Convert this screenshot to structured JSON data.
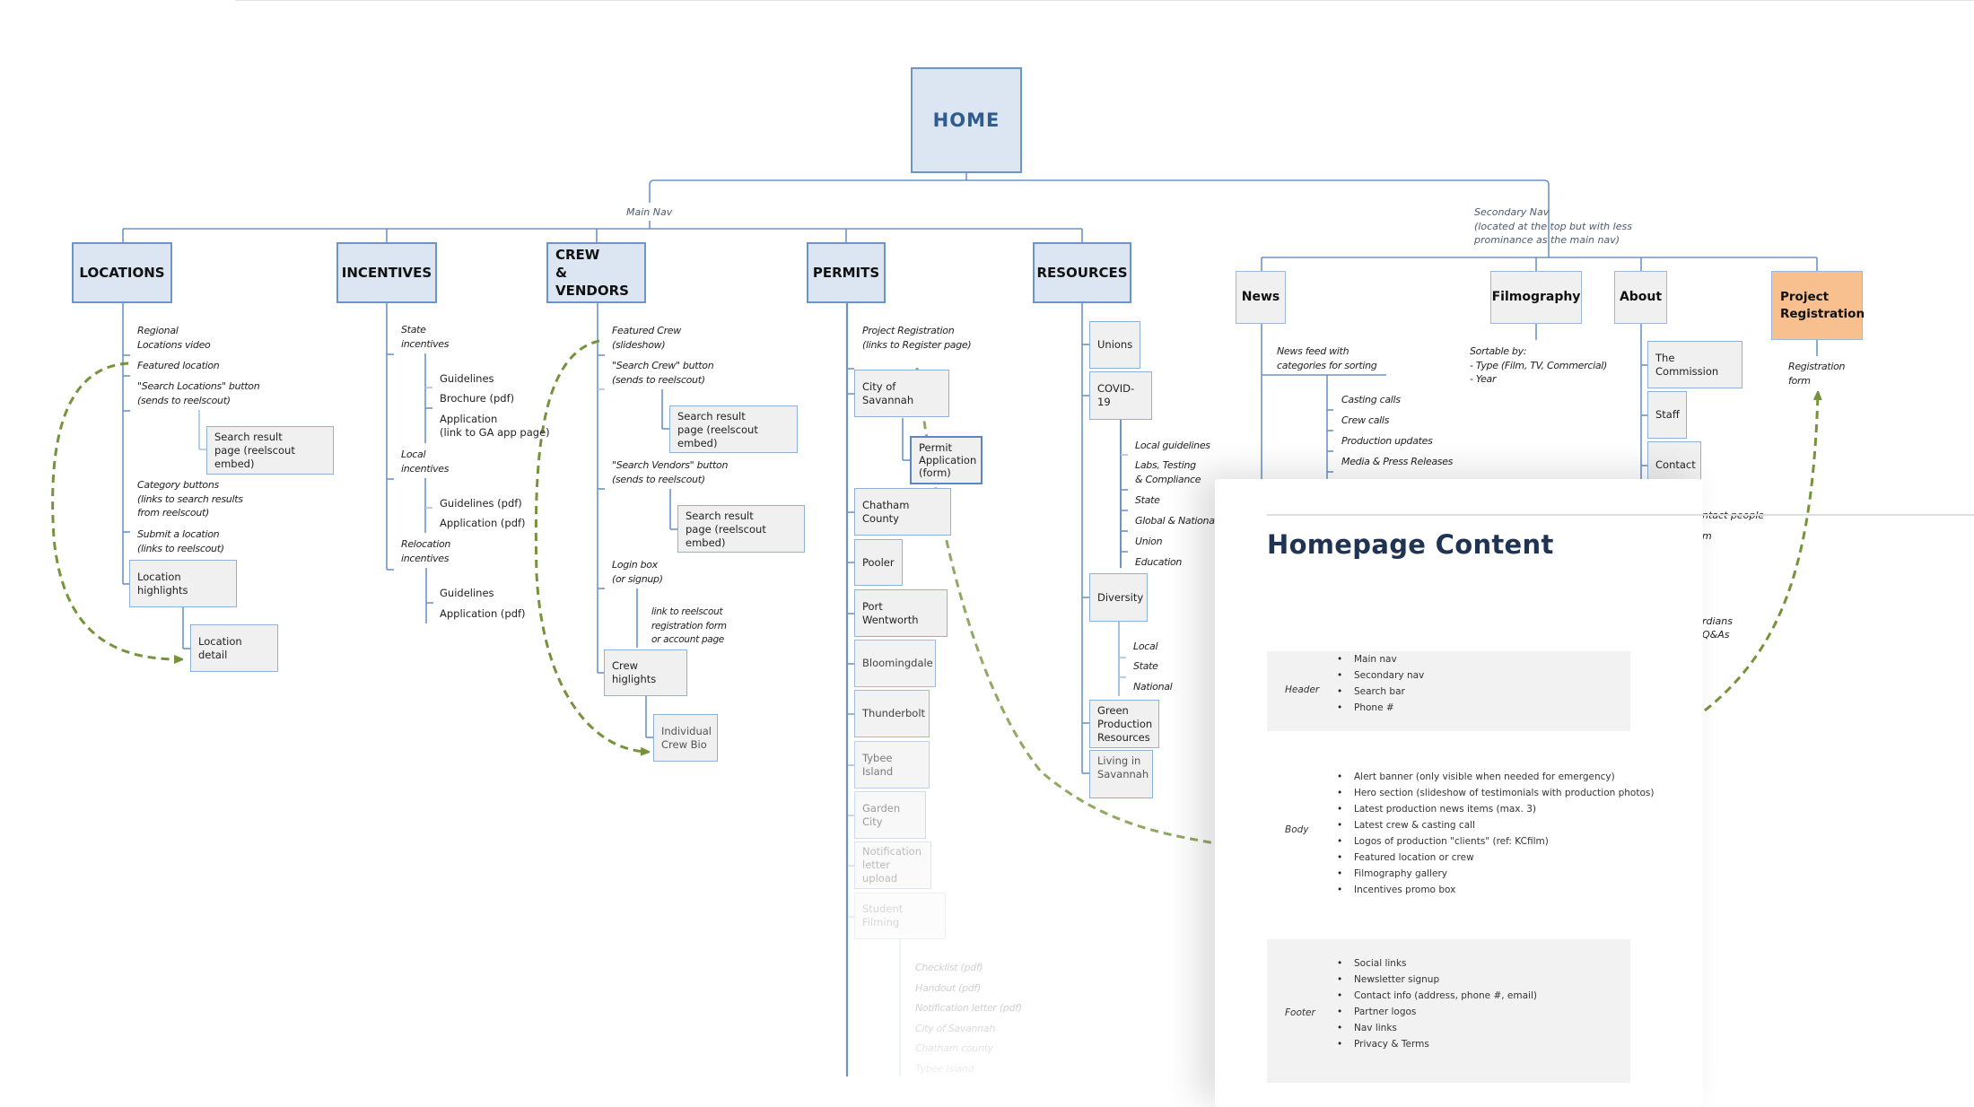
{
  "home": {
    "label": "HOME"
  },
  "main_nav": {
    "label": "Main Nav",
    "items": [
      {
        "label": "LOCATIONS"
      },
      {
        "label": "INCENTIVES"
      },
      {
        "label": "CREW\n& VENDORS",
        "line1": "CREW",
        "line2": "& VENDORS"
      },
      {
        "label": "PERMITS"
      },
      {
        "label": "RESOURCES"
      }
    ]
  },
  "secondary_nav": {
    "label_line1": "Secondary Nav",
    "label_line2": "(located at the top but with less",
    "label_line3": "prominance as the main nav)",
    "items": [
      {
        "label": "News"
      },
      {
        "label": "Filmography"
      },
      {
        "label": "About"
      },
      {
        "label_line1": "Project",
        "label_line2": "Registration"
      }
    ]
  },
  "locations": {
    "notes": [
      [
        "Regional",
        "Locations video"
      ],
      [
        "Featured location"
      ],
      [
        "\"Search Locations\" button",
        "(sends to reelscout)"
      ],
      [
        "Category buttons",
        "(links to search results",
        "from reelscout)"
      ],
      [
        "Submit a location",
        "(links to reelscout)"
      ]
    ],
    "search_result": [
      "Search result",
      "page (reelscout embed)"
    ],
    "highlights": "Location highlights",
    "detail": "Location detail"
  },
  "incentives": {
    "groups": [
      {
        "title": [
          "State",
          "incentives"
        ],
        "items": [
          "Guidelines",
          "Brochure (pdf)",
          "Application",
          "(link to GA app page)"
        ]
      },
      {
        "title": [
          "Local",
          "incentives"
        ],
        "items": [
          "Guidelines (pdf)",
          "Application (pdf)"
        ]
      },
      {
        "title": [
          "Relocation",
          "incentives"
        ],
        "items": [
          "Guidelines",
          "Application (pdf)"
        ]
      }
    ]
  },
  "crew": {
    "notes": [
      [
        "Featured Crew",
        "(slideshow)"
      ],
      [
        "\"Search Crew\" button",
        "(sends to reelscout)"
      ],
      [
        "\"Search Vendors\" button",
        "(sends to reelscout)"
      ],
      [
        "Login box",
        "(or signup)"
      ],
      [
        "link to reelscout",
        "registration form",
        "or account page"
      ]
    ],
    "search_result_1": [
      "Search result",
      "page (reelscout embed)"
    ],
    "search_result_2": [
      "Search result",
      "page (reelscout embed)"
    ],
    "highlights": "Crew higlights",
    "bio": [
      "Individual",
      "Crew Bio"
    ]
  },
  "permits": {
    "note": [
      "Project Registration",
      "(links to Register page)"
    ],
    "boxes": [
      "City of Savannah",
      "Chatham County",
      "Pooler",
      "Port Wentworth",
      "Bloomingdale",
      "Thunderbolt",
      "Tybee Island",
      "Garden City",
      "Notification letter upload",
      "Student Filming"
    ],
    "notification_lines": [
      "Notification",
      "letter upload"
    ],
    "permit_application": [
      "Permit",
      "Application",
      "(form)"
    ],
    "student_items": [
      "Checklist (pdf)",
      "Handout (pdf)",
      "Notification letter (pdf)",
      "City of Savannah",
      "Chatham county",
      "Tybee Island"
    ]
  },
  "resources": {
    "unions": "Unions",
    "covid": "COVID-19",
    "covid_items": [
      "Local guidelines",
      "Labs, Testing",
      "& Compliance",
      "State",
      "Global & Nationa",
      "Union",
      "Education"
    ],
    "diversity": "Diversity",
    "diversity_items": [
      "Local",
      "State",
      "National"
    ],
    "green": [
      "Green",
      "Production",
      "Resources"
    ],
    "living": [
      "Living in",
      "Savannah"
    ]
  },
  "news": {
    "note": [
      "News feed with",
      "categories for sorting"
    ],
    "categories": [
      "Casting calls",
      "Crew calls",
      "Production updates",
      "Media & Press Releases"
    ]
  },
  "filmography": {
    "note": [
      "Sortable by:",
      "- Type (Film, TV, Commercial)",
      "- Year"
    ]
  },
  "about": {
    "items": [
      "The Commission",
      "Staff",
      "Contact"
    ],
    "partial_notes": [
      "ntact people",
      "m",
      "rdians",
      "Q&As"
    ]
  },
  "registration": {
    "note": [
      "Registration",
      "form"
    ]
  },
  "homepage_card": {
    "title": "Homepage Content",
    "sections": [
      {
        "label": "Header",
        "items": [
          "Main nav",
          "Secondary nav",
          "Search bar",
          "Phone #"
        ]
      },
      {
        "label": "Body",
        "items": [
          "Alert banner (only visible when needed for emergency)",
          "Hero section (slideshow of testimonials with production photos)",
          "Latest production news items (max. 3)",
          "Latest crew & casting call",
          "Logos of production \"clients\" (ref: KCfilm)",
          "Featured location or crew",
          "Filmography gallery",
          "Incentives promo box"
        ]
      },
      {
        "label": "Footer",
        "items": [
          "Social links",
          "Newsletter signup",
          "Contact info (address, phone #, email)",
          "Partner logos",
          "Nav links",
          "Privacy & Terms"
        ]
      }
    ]
  },
  "colors": {
    "connector": "#6d94c6",
    "nav_fill": "#dce6f3",
    "box_fill": "#f0f0f0",
    "registration_fill": "#f8bf8f",
    "dashed_arrow": "#76923c",
    "card_title": "#1f3352"
  }
}
